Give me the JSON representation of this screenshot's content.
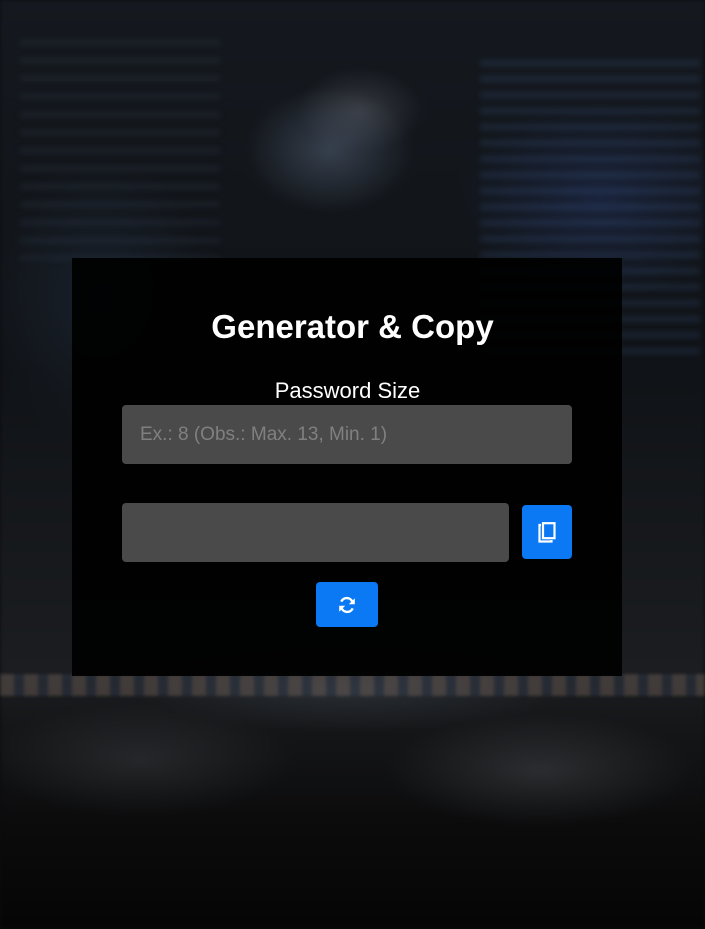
{
  "app": {
    "title": "Generator & Copy"
  },
  "size_field": {
    "label": "Password Size",
    "placeholder": "Ex.: 8 (Obs.: Max. 13, Min. 1)",
    "value": ""
  },
  "output_field": {
    "value": ""
  },
  "icons": {
    "copy": "copy-icon",
    "refresh": "refresh-icon"
  },
  "colors": {
    "accent": "#0a79f3",
    "input_bg": "#4a4a4a",
    "panel_bg": "#000000",
    "text": "#ffffff"
  }
}
